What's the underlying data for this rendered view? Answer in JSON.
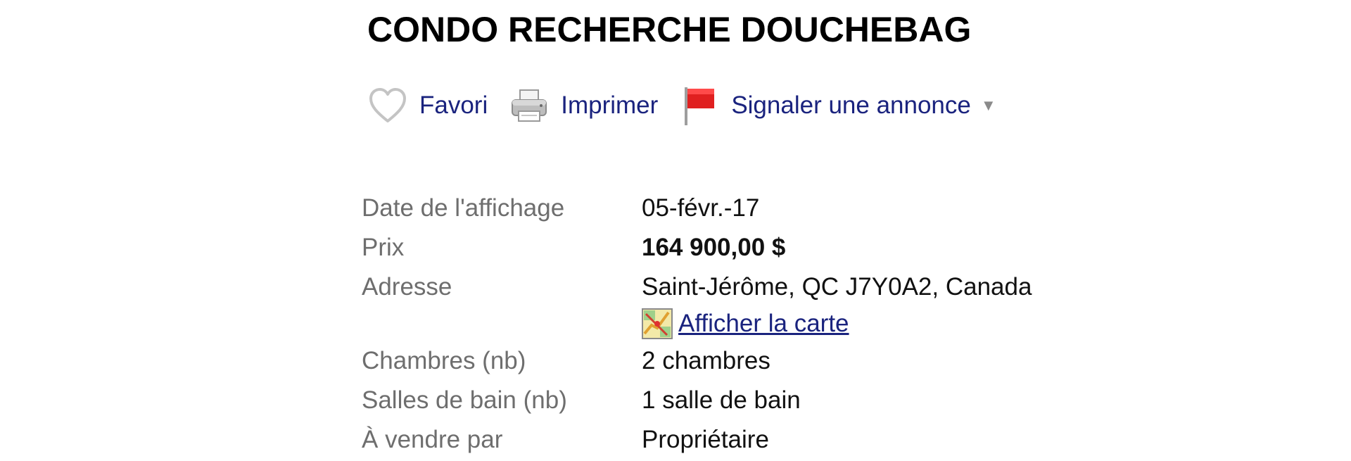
{
  "listing": {
    "title": "CONDO RECHERCHE DOUCHEBAG"
  },
  "actions": {
    "favorite_label": "Favori",
    "favorite_icon": "heart-outline-icon",
    "print_label": "Imprimer",
    "print_icon": "printer-icon",
    "report_label": "Signaler une annonce",
    "report_icon": "red-flag-icon",
    "report_caret": "▼"
  },
  "details": {
    "rows": [
      {
        "label": "Date de l'affichage",
        "value": "05-févr.-17"
      },
      {
        "label": "Prix",
        "value": "164 900,00 $"
      },
      {
        "label": "Adresse",
        "value": "Saint-Jérôme, QC J7Y0A2, Canada",
        "map_link": "Afficher la carte",
        "map_icon": "map-icon"
      },
      {
        "label": "Chambres (nb)",
        "value": "2 chambres"
      },
      {
        "label": "Salles de bain (nb)",
        "value": "1 salle de bain"
      },
      {
        "label": "À vendre par",
        "value": "Propriétaire"
      }
    ]
  },
  "colors": {
    "link": "#1a237e",
    "label_gray": "#6e6e6e",
    "flag_red": "#e02020"
  }
}
